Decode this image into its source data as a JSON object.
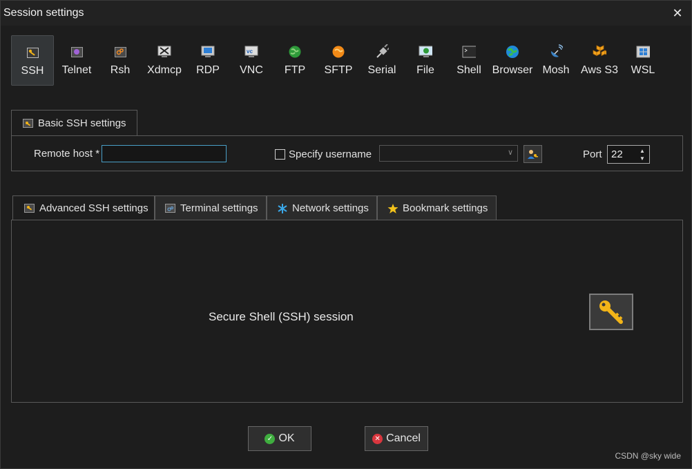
{
  "window": {
    "title": "Session settings",
    "close_glyph": "✕"
  },
  "protocols": [
    {
      "label": "SSH",
      "icon": "ssh-key-icon",
      "active": true
    },
    {
      "label": "Telnet",
      "icon": "telnet-icon"
    },
    {
      "label": "Rsh",
      "icon": "rsh-icon"
    },
    {
      "label": "Xdmcp",
      "icon": "xdmcp-icon"
    },
    {
      "label": "RDP",
      "icon": "rdp-icon"
    },
    {
      "label": "VNC",
      "icon": "vnc-icon"
    },
    {
      "label": "FTP",
      "icon": "ftp-globe-icon"
    },
    {
      "label": "SFTP",
      "icon": "sftp-icon"
    },
    {
      "label": "Serial",
      "icon": "serial-plug-icon"
    },
    {
      "label": "File",
      "icon": "file-monitor-icon"
    },
    {
      "label": "Shell",
      "icon": "shell-terminal-icon"
    },
    {
      "label": "Browser",
      "icon": "browser-globe-icon"
    },
    {
      "label": "Mosh",
      "icon": "mosh-satellite-icon"
    },
    {
      "label": "Aws S3",
      "icon": "aws-s3-cubes-icon"
    },
    {
      "label": "WSL",
      "icon": "wsl-windows-icon"
    }
  ],
  "basic": {
    "tab_label": "Basic SSH settings",
    "remote_host_label": "Remote host *",
    "remote_host_value": "",
    "specify_username_label": "Specify username",
    "specify_username_checked": false,
    "username_value": "",
    "port_label": "Port",
    "port_value": "22"
  },
  "advanced_tabs": [
    {
      "label": "Advanced SSH settings",
      "icon": "wrench-key-icon"
    },
    {
      "label": "Terminal settings",
      "icon": "terminal-settings-icon"
    },
    {
      "label": "Network settings",
      "icon": "network-star-icon"
    },
    {
      "label": "Bookmark settings",
      "icon": "bookmark-star-icon"
    }
  ],
  "session_description": "Secure Shell (SSH) session",
  "buttons": {
    "ok": "OK",
    "cancel": "Cancel"
  },
  "watermark": "CSDN @sky wide",
  "colors": {
    "accent_input_border": "#4aa0c8",
    "key_gold": "#f2b418",
    "ok_green": "#3fae3f",
    "cancel_red": "#d9363e"
  }
}
